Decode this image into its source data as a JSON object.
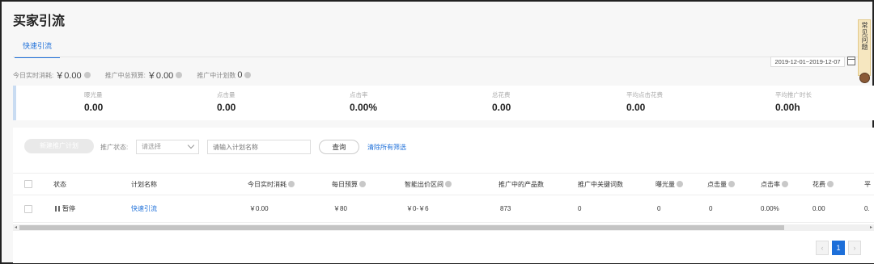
{
  "page": {
    "title": "买家引流"
  },
  "tabs": [
    {
      "label": "快速引流",
      "active": true
    }
  ],
  "help": {
    "label": "常见问题"
  },
  "stats": [
    {
      "label": "今日实时消耗:",
      "value": "￥0.00"
    },
    {
      "label": "推广中总预算:",
      "value": "￥0.00"
    },
    {
      "label": "推广中计划数",
      "value": "0"
    }
  ],
  "date_range": "2019-12-01~2019-12-07",
  "metrics": [
    {
      "label": "曝光量",
      "value": "0.00"
    },
    {
      "label": "点击量",
      "value": "0.00"
    },
    {
      "label": "点击率",
      "value": "0.00%"
    },
    {
      "label": "总花费",
      "value": "0.00"
    },
    {
      "label": "平均点击花费",
      "value": "0.00"
    },
    {
      "label": "平均推广时长",
      "value": "0.00h"
    }
  ],
  "toolbar": {
    "new_plan": "新建推广计划",
    "status_label": "推广状态:",
    "status_select": "请选择",
    "search_placeholder": "请输入计划名称",
    "query": "查询",
    "clear": "清除所有筛选"
  },
  "table": {
    "columns": [
      "状态",
      "计划名称",
      "今日实时消耗",
      "每日预算",
      "智能出价区间",
      "推广中的产品数",
      "推广中关键词数",
      "曝光量",
      "点击量",
      "点击率",
      "花费",
      "平"
    ],
    "rows": [
      {
        "status": "暂停",
        "name": "快速引流",
        "cost": "￥0.00",
        "budget": "￥80",
        "bid": "￥0-￥6",
        "products": "873",
        "keywords": "0",
        "impressions": "0",
        "clicks": "0",
        "ctr": "0.00%",
        "spend": "0.00",
        "avg": "0."
      }
    ]
  },
  "pagination": {
    "prev": "‹",
    "current": "1",
    "next": "›"
  },
  "colors": {
    "accent": "#1d6fd9"
  }
}
